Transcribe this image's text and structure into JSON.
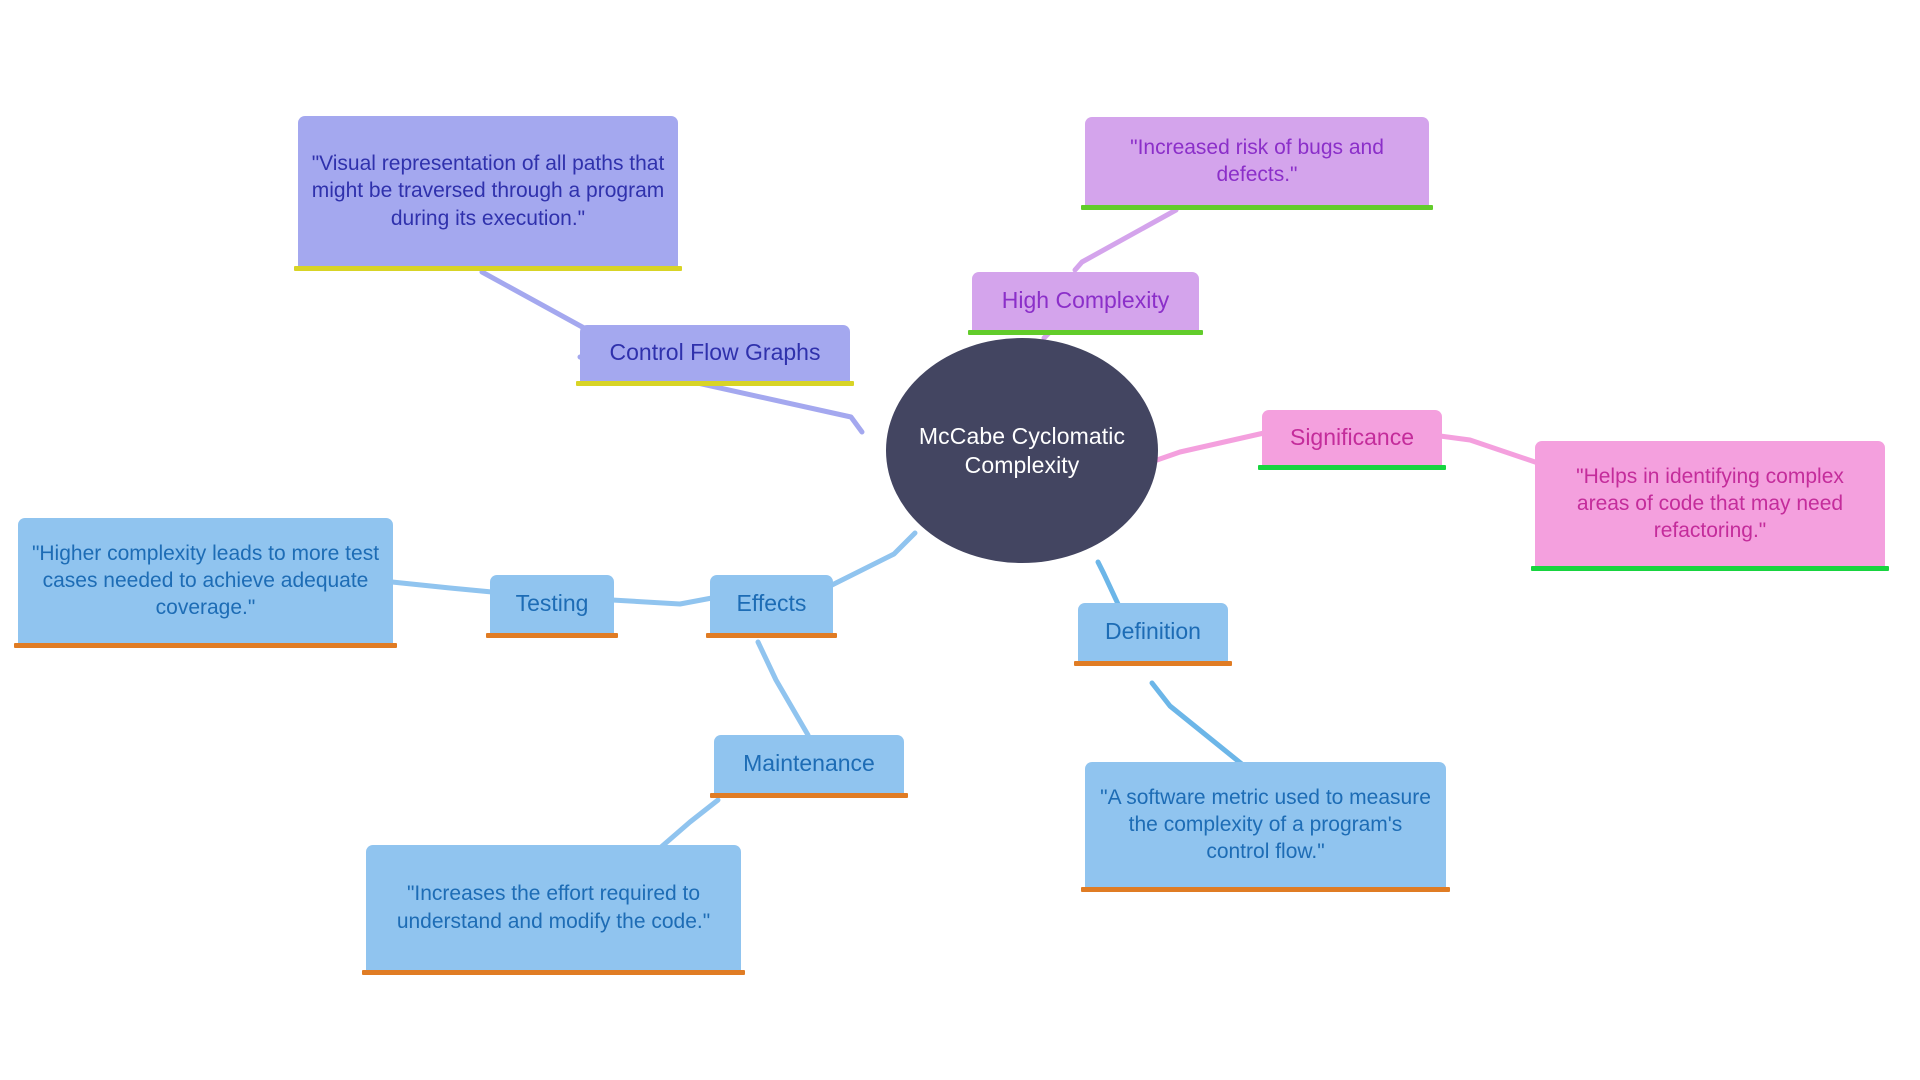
{
  "diagram": {
    "type": "mindmap",
    "title": "McCabe Cyclomatic Complexity",
    "center": {
      "label": "McCabe Cyclomatic Complexity",
      "fill": "#434561",
      "text_color": "#ffffff"
    },
    "branches": [
      {
        "id": "control-flow-graphs",
        "label": "Control Flow Graphs",
        "fill": "#a4a8ef",
        "text_color": "#2f31ac",
        "accent": "#d8d426",
        "children": [
          {
            "id": "cfg-detail",
            "label": "\"Visual representation of all paths that might be traversed through a program during its execution.\""
          }
        ]
      },
      {
        "id": "high-complexity",
        "label": "High Complexity",
        "fill": "#d4a4ec",
        "text_color": "#8b2fc9",
        "accent": "#62cc2b",
        "children": [
          {
            "id": "high-complexity-detail",
            "label": "\"Increased risk of bugs and defects.\""
          }
        ]
      },
      {
        "id": "significance",
        "label": "Significance",
        "fill": "#f4a0de",
        "text_color": "#c42c9b",
        "accent": "#17d43f",
        "children": [
          {
            "id": "significance-detail",
            "label": "\"Helps in identifying complex areas of code that may need refactoring.\""
          }
        ]
      },
      {
        "id": "definition",
        "label": "Definition",
        "fill": "#90c4ef",
        "text_color": "#1d6cb5",
        "accent": "#e07c24",
        "children": [
          {
            "id": "definition-detail",
            "label": "\"A software metric used to measure the complexity of a program's control flow.\""
          }
        ]
      },
      {
        "id": "effects",
        "label": "Effects",
        "fill": "#90c4ef",
        "text_color": "#1d6cb5",
        "accent": "#e07c24",
        "children": [
          {
            "id": "testing",
            "label": "Testing",
            "children": [
              {
                "id": "testing-detail",
                "label": "\"Higher complexity leads to more test cases needed to achieve adequate coverage.\""
              }
            ]
          },
          {
            "id": "maintenance",
            "label": "Maintenance",
            "children": [
              {
                "id": "maintenance-detail",
                "label": "\"Increases the effort required to understand and modify the code.\""
              }
            ]
          }
        ]
      }
    ],
    "edge_colors": {
      "periwinkle": "#a4a8ef",
      "violet": "#d4a4ec",
      "pink": "#f4a0de",
      "blue": "#90c4ef"
    },
    "background": "#ffffff"
  }
}
